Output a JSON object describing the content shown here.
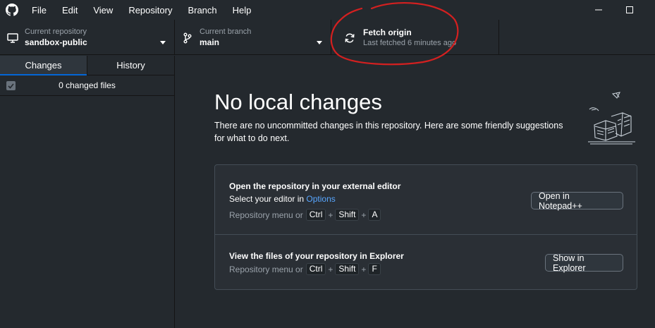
{
  "menu": {
    "items": [
      "File",
      "Edit",
      "View",
      "Repository",
      "Branch",
      "Help"
    ]
  },
  "toolbar": {
    "repository": {
      "label": "Current repository",
      "value": "sandbox-public"
    },
    "branch": {
      "label": "Current branch",
      "value": "main"
    },
    "fetch": {
      "label": "Fetch origin",
      "status": "Last fetched 6 minutes ago"
    }
  },
  "sidebar": {
    "tabs": [
      {
        "label": "Changes",
        "active": true
      },
      {
        "label": "History",
        "active": false
      }
    ],
    "changes_count": "0 changed files"
  },
  "main": {
    "headline": "No local changes",
    "subtext": "There are no uncommitted changes in this repository. Here are some friendly suggestions for what to do next.",
    "suggestions": [
      {
        "title": "Open the repository in your external editor",
        "line_prefix": "Select your editor in ",
        "line_link": "Options",
        "shortcut_prefix": "Repository menu or",
        "keys": [
          "Ctrl",
          "Shift",
          "A"
        ],
        "button": "Open in Notepad++"
      },
      {
        "title": "View the files of your repository in Explorer",
        "shortcut_prefix": "Repository menu or",
        "keys": [
          "Ctrl",
          "Shift",
          "F"
        ],
        "button": "Show in Explorer"
      }
    ]
  },
  "colors": {
    "background": "#24292e",
    "border": "#141414",
    "link": "#58a6ff",
    "accent": "#0366d6",
    "annotation": "#d42020"
  },
  "icons": [
    "github-logo-icon",
    "minimize-icon",
    "maximize-icon",
    "desktop-icon",
    "branch-icon",
    "sync-icon",
    "chevron-down-icon",
    "checkbox-icon"
  ]
}
